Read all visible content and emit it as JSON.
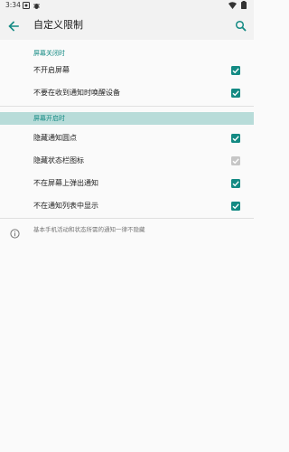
{
  "status_bar": {
    "time": "3:34",
    "icons": [
      "notification-badge-icon",
      "debug-icon",
      "wifi-icon",
      "battery-icon"
    ]
  },
  "toolbar": {
    "title": "自定义限制",
    "back_icon": "arrow-back-icon",
    "search_icon": "search-icon"
  },
  "sections": [
    {
      "header": "屏幕关闭时",
      "items": [
        {
          "label": "不开启屏幕",
          "checked": true,
          "enabled": true
        },
        {
          "label": "不要在收到通知时唤醒设备",
          "checked": true,
          "enabled": true
        }
      ]
    },
    {
      "header": "屏幕开启时",
      "highlighted": true,
      "items": [
        {
          "label": "隐藏通知圆点",
          "checked": true,
          "enabled": true
        },
        {
          "label": "隐藏状态栏图标",
          "checked": true,
          "enabled": false
        },
        {
          "label": "不在屏幕上弹出通知",
          "checked": true,
          "enabled": true
        },
        {
          "label": "不在通知列表中显示",
          "checked": true,
          "enabled": true
        }
      ]
    }
  ],
  "info": {
    "icon": "info-icon",
    "text": "基本手机活动和状态所需的通知一律不隐藏"
  },
  "colors": {
    "accent": "#138a83",
    "section_highlight": "#b8dcd9",
    "disabled_checkbox": "#c6c6c6",
    "background": "#fafafa"
  }
}
